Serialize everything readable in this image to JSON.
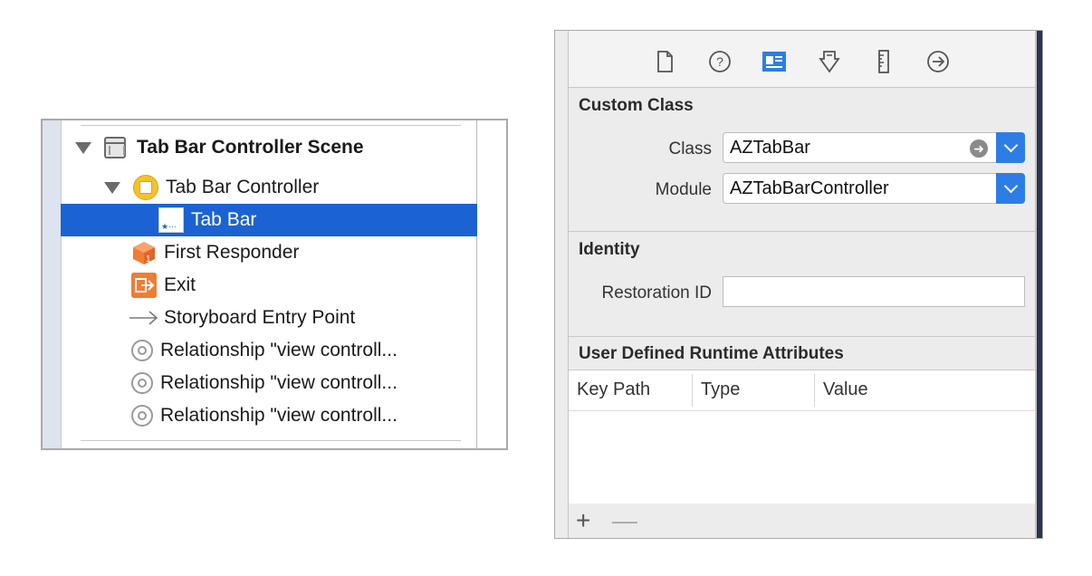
{
  "outline": {
    "rows": [
      {
        "label": "Tab Bar Controller Scene"
      },
      {
        "label": "Tab Bar Controller"
      },
      {
        "label": "Tab Bar"
      },
      {
        "label": "First Responder"
      },
      {
        "label": "Exit"
      },
      {
        "label": "Storyboard Entry Point"
      },
      {
        "label": "Relationship \"view controll..."
      },
      {
        "label": "Relationship \"view controll..."
      },
      {
        "label": "Relationship \"view controll..."
      }
    ],
    "selected_color": "#1b63d2"
  },
  "inspector": {
    "tabs": [
      {
        "icon": "file-icon"
      },
      {
        "icon": "help-icon"
      },
      {
        "icon": "identity-icon"
      },
      {
        "icon": "attributes-icon"
      },
      {
        "icon": "size-ruler-icon"
      },
      {
        "icon": "connections-arrow-icon"
      }
    ],
    "custom_class": {
      "header": "Custom Class",
      "class_label": "Class",
      "class_value": "AZTabBar",
      "module_label": "Module",
      "module_value": "AZTabBarController"
    },
    "identity": {
      "header": "Identity",
      "restoration_label": "Restoration ID",
      "restoration_value": ""
    },
    "runtime_attributes": {
      "header": "User Defined Runtime Attributes",
      "columns": [
        "Key Path",
        "Type",
        "Value"
      ],
      "add_label": "+",
      "remove_label": "—"
    },
    "accent": "#2d7de6"
  }
}
